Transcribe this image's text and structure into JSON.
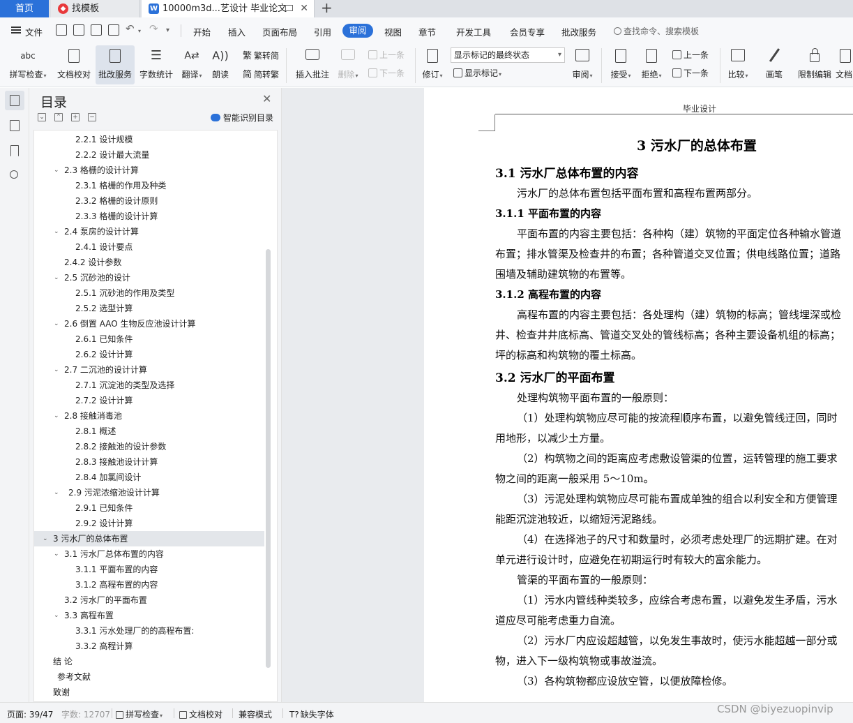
{
  "tabs": {
    "home": "首页",
    "template": "找模板",
    "document": "10000m3d...艺设计 毕业论文",
    "template_icon": "wps-template-icon",
    "document_icon": "wps-writer-icon"
  },
  "menu": {
    "file": "文件",
    "items": [
      "开始",
      "插入",
      "页面布局",
      "引用",
      "审阅",
      "视图",
      "章节",
      "开发工具",
      "会员专享",
      "批改服务"
    ],
    "active": "审阅",
    "search_placeholder": "查找命令、搜索模板"
  },
  "ribbon": {
    "spell_check": "拼写检查",
    "doc_proof": "文档校对",
    "correction_service": "批改服务",
    "word_count": "字数统计",
    "translate": "翻译",
    "read_aloud": "朗读",
    "trad_to_simp": "繁转简",
    "simp_to_trad": "简转繁",
    "insert_comment": "插入批注",
    "delete": "删除",
    "prev_comment": "上一条",
    "next_comment": "下一条",
    "track_changes": "修订",
    "markup_dropdown": "显示标记的最终状态",
    "show_markup": "显示标记",
    "review": "审阅",
    "accept": "接受",
    "reject": "拒绝",
    "prev_change": "上一条",
    "next_change": "下一条",
    "compare": "比较",
    "ink": "画笔",
    "restrict_edit": "限制编辑",
    "doc_more": "文档"
  },
  "toc": {
    "title": "目录",
    "smart_label": "智能识别目录",
    "items": [
      {
        "text": "2.2.1  设计规模",
        "level": 3
      },
      {
        "text": "2.2.2  设计最大流量",
        "level": 3
      },
      {
        "text": "2.3  格栅的设计计算",
        "level": 2,
        "expand": true
      },
      {
        "text": "2.3.1 格栅的作用及种类",
        "level": 3
      },
      {
        "text": "2.3.2 格栅的设计原则",
        "level": 3
      },
      {
        "text": "2.3.3  格栅的设计计算",
        "level": 3
      },
      {
        "text": "2.4  泵房的设计计算",
        "level": 2,
        "expand": true
      },
      {
        "text": "2.4.1  设计要点",
        "level": 3
      },
      {
        "text": "2.4.2  设计参数",
        "level": 2
      },
      {
        "text": "2.5 沉砂池的设计",
        "level": 2,
        "expand": true
      },
      {
        "text": "2.5.1 沉砂池的作用及类型",
        "level": 3
      },
      {
        "text": "2.5.2  选型计算",
        "level": 3
      },
      {
        "text": "2.6  倒置 AAO 生物反应池设计计算",
        "level": 2,
        "expand": true
      },
      {
        "text": "2.6.1  已知条件",
        "level": 3
      },
      {
        "text": "2.6.2  设计计算",
        "level": 3
      },
      {
        "text": "2.7  二沉池的设计计算",
        "level": 2,
        "expand": true
      },
      {
        "text": "2.7.1 沉淀池的类型及选择",
        "level": 3
      },
      {
        "text": "2.7.2 设计计算",
        "level": 3
      },
      {
        "text": "2.8  接触消毒池",
        "level": 2,
        "expand": true
      },
      {
        "text": "2.8.1 概述",
        "level": 3
      },
      {
        "text": "2.8.2 接触池的设计参数",
        "level": 3
      },
      {
        "text": "2.8.3  接触池设计计算",
        "level": 3
      },
      {
        "text": "2.8.4  加氯间设计",
        "level": 3
      },
      {
        "text": "2.9  污泥浓缩池设计计算",
        "level": 2,
        "expand": true,
        "extra": true
      },
      {
        "text": "2.9.1  已知条件",
        "level": 3
      },
      {
        "text": "2.9.2 设计计算",
        "level": 3
      },
      {
        "text": "3  污水厂的总体布置",
        "level": 1,
        "expand": true,
        "selected": true
      },
      {
        "text": "3.1  污水厂总体布置的内容",
        "level": 2,
        "expand": true
      },
      {
        "text": "3.1.1  平面布置的内容",
        "level": 3
      },
      {
        "text": "3.1.2 高程布置的内容",
        "level": 3
      },
      {
        "text": "3.2  污水厂的平面布置",
        "level": 2
      },
      {
        "text": "3.3  高程布置",
        "level": 2,
        "expand": true
      },
      {
        "text": "3.3.1 污水处理厂的的高程布置:",
        "level": 3
      },
      {
        "text": "3.3.2 高程计算",
        "level": 3
      },
      {
        "text": "结  论",
        "level": 0
      },
      {
        "text": "参考文献",
        "level": 0,
        "extra": true
      },
      {
        "text": "致谢",
        "level": 0
      }
    ]
  },
  "document": {
    "header": "毕业设计",
    "chapter_title": "3  污水厂的总体布置",
    "lines": [
      {
        "type": "h2",
        "text": "3.1  污水厂总体布置的内容"
      },
      {
        "type": "p",
        "indent": true,
        "text": "污水厂的总体布置包括平面布置和高程布置两部分。"
      },
      {
        "type": "h3",
        "text": "3.1.1  平面布置的内容"
      },
      {
        "type": "p",
        "indent": true,
        "text": "平面布置的内容主要包括：各种构（建）筑物的平面定位各种输水管道"
      },
      {
        "type": "p",
        "text": "布置；排水管渠及检查井的布置；各种管道交叉位置；供电线路位置；道路"
      },
      {
        "type": "p",
        "text": "围墙及辅助建筑物的布置等。"
      },
      {
        "type": "h3",
        "text": "3.1.2 高程布置的内容"
      },
      {
        "type": "p",
        "indent": true,
        "text": "高程布置的内容主要包括：各处理构（建）筑物的标高；管线埋深或检"
      },
      {
        "type": "p",
        "text": "井、检查井井底标高、管道交叉处的管线标高；各种主要设备机组的标高；"
      },
      {
        "type": "p",
        "text": "坪的标高和构筑物的覆土标高。"
      },
      {
        "type": "h2",
        "text": "3.2  污水厂的平面布置"
      },
      {
        "type": "p",
        "indent": true,
        "text": "处理构筑物平面布置的一般原则："
      },
      {
        "type": "p",
        "indent": true,
        "text": "（1）处理构筑物应尽可能的按流程顺序布置，以避免管线迂回，同时"
      },
      {
        "type": "p",
        "text": "用地形，以减少土方量。"
      },
      {
        "type": "p",
        "indent": true,
        "text": "（2）构筑物之间的距离应考虑敷设管渠的位置，运转管理的施工要求"
      },
      {
        "type": "p",
        "text": "物之间的距离一般采用 5～10m。"
      },
      {
        "type": "p",
        "indent": true,
        "text": "（3）污泥处理构筑物应尽可能布置成单独的组合以利安全和方便管理"
      },
      {
        "type": "p",
        "text": "能距沉淀池较近，以缩短污泥路线。"
      },
      {
        "type": "p",
        "indent": true,
        "text": "（4）在选择池子的尺寸和数量时，必须考虑处理厂的远期扩建。在对"
      },
      {
        "type": "p",
        "text": "单元进行设计时，应避免在初期运行时有较大的富余能力。"
      },
      {
        "type": "p",
        "indent": true,
        "text": "管渠的平面布置的一般原则："
      },
      {
        "type": "p",
        "indent": true,
        "text": "（1）污水内管线种类较多，应综合考虑布置，以避免发生矛盾，污水"
      },
      {
        "type": "p",
        "text": "道应尽可能考虑重力自流。"
      },
      {
        "type": "p",
        "indent": true,
        "text": "（2）污水厂内应设超越管，以免发生事故时，使污水能超越一部分或"
      },
      {
        "type": "p",
        "text": "物，进入下一级构筑物或事故溢流。"
      },
      {
        "type": "p",
        "indent": true,
        "text": "（3）各构筑物都应设放空管，以便放障检修。"
      }
    ]
  },
  "status": {
    "page": "页面: 39/47",
    "words": "字数: 12707",
    "spell": "拼写检查",
    "proof": "文档校对",
    "compat": "兼容模式",
    "missing_font": "缺失字体"
  },
  "watermark": "CSDN @biyezuopinvip",
  "colors": {
    "accent": "#2b71d9",
    "tab_bar": "#dee1e6",
    "panel": "#f3f4f6",
    "canvas": "#e9ebee"
  }
}
